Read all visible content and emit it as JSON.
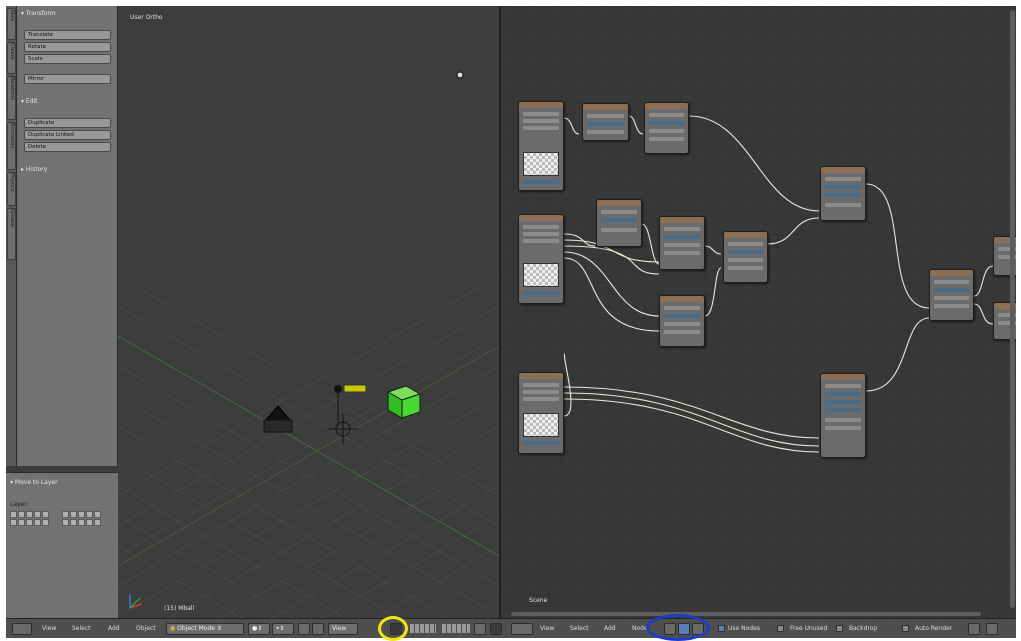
{
  "viewport": {
    "title": "User Ortho",
    "object_label": "(15) Mball"
  },
  "toolshelf": {
    "transform_header": "▾ Transform",
    "transform_buttons": [
      "Translate",
      "Rotate",
      "Scale",
      "Mirror"
    ],
    "edit_header": "▾ Edit",
    "edit_buttons": [
      "Duplicate",
      "Duplicate Linked",
      "Delete"
    ],
    "history_header": "▸ History",
    "tabs": [
      "Tools",
      "Create",
      "Relations",
      "Animation",
      "Physics",
      "Grease"
    ]
  },
  "layers_panel": {
    "header": "▾ Move to Layer",
    "label": "Layer:"
  },
  "node_editor": {
    "scene_label": "Scene"
  },
  "footer": {
    "left_menus": [
      "View",
      "Select",
      "Add",
      "Object"
    ],
    "mode": "Object Mode",
    "view_button": "View",
    "right_menus": [
      "View",
      "Select",
      "Add",
      "Node"
    ],
    "use_nodes": "Use Nodes",
    "free_unused": "Free Unused",
    "backdrop": "Backdrop",
    "auto_render": "Auto Render"
  },
  "icons": [
    "editor-type-icon",
    "layers-grid-icon",
    "node-tree-type-icon",
    "render-layers-icon",
    "axes-gizmo-icon",
    "camera-icon",
    "lamp-icon",
    "cube-icon"
  ],
  "annotation_colors": {
    "yellow": "#f2e60f",
    "blue": "#1e3cc8"
  }
}
